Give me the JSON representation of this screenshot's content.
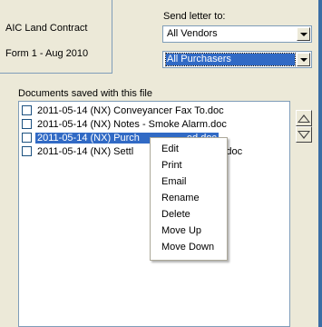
{
  "header": {
    "contract_name": "AIC Land Contract",
    "form_name": "Form 1 - Aug 2010"
  },
  "send_letter": {
    "label": "Send letter to:",
    "recipient_1": "All Vendors",
    "recipient_2": "All Purchasers"
  },
  "documents": {
    "label": "Documents saved with this file",
    "items": [
      {
        "checked": false,
        "label": "2011-05-14 (NX)  Conveyancer Fax To.doc"
      },
      {
        "checked": false,
        "label": "2011-05-14 (NX)  Notes - Smoke Alarm.doc"
      },
      {
        "checked": false,
        "label": "2011-05-14 (NX)  Purch",
        "label_obscured_end": "ed.doc",
        "selected": true
      },
      {
        "checked": false,
        "label": "2011-05-14 (NX)  Settl",
        "label_obscured_end": "th.doc"
      }
    ]
  },
  "context_menu": {
    "items": [
      "Edit",
      "Print",
      "Email",
      "Rename",
      "Delete",
      "Move Up",
      "Move Down"
    ]
  },
  "icons": {
    "move_up": "triangle-up-icon",
    "move_down": "triangle-down-icon",
    "dropdown": "chevron-down-icon"
  },
  "colors": {
    "selection": "#316ac5",
    "window_bg": "#ece9d8",
    "border": "#7f9db9"
  }
}
